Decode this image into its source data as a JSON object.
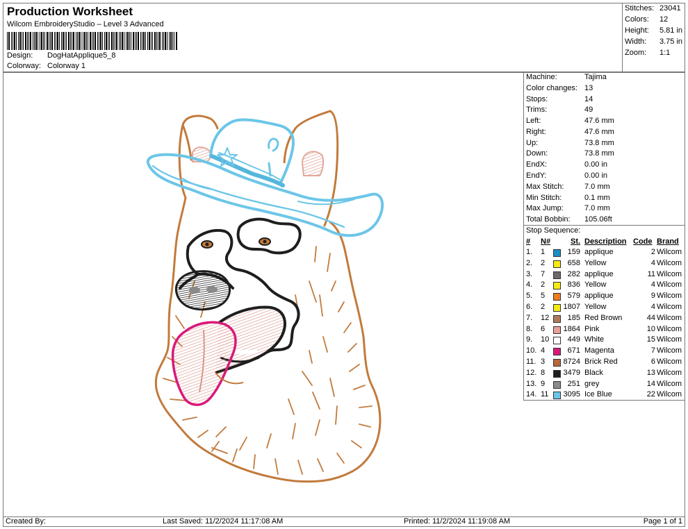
{
  "header": {
    "title": "Production Worksheet",
    "subtitle": "Wilcom EmbroideryStudio – Level 3 Advanced",
    "design_label": "Design:",
    "design_value": "DogHatApplique5_8",
    "colorway_label": "Colorway:",
    "colorway_value": "Colorway 1"
  },
  "stats": [
    {
      "k": "Stitches:",
      "v": "23041"
    },
    {
      "k": "Colors:",
      "v": "12"
    },
    {
      "k": "Height:",
      "v": "5.81 in"
    },
    {
      "k": "Width:",
      "v": "3.75 in"
    },
    {
      "k": "Zoom:",
      "v": "1:1"
    }
  ],
  "machine": [
    {
      "k": "Machine:",
      "v": "Tajima"
    },
    {
      "k": "Color changes:",
      "v": "13"
    },
    {
      "k": "Stops:",
      "v": "14"
    },
    {
      "k": "Trims:",
      "v": "49"
    },
    {
      "k": "Left:",
      "v": "47.6 mm"
    },
    {
      "k": "Right:",
      "v": "47.6 mm"
    },
    {
      "k": "Up:",
      "v": "73.8 mm"
    },
    {
      "k": "Down:",
      "v": "73.8 mm"
    },
    {
      "k": "EndX:",
      "v": "0.00 in"
    },
    {
      "k": "EndY:",
      "v": "0.00 in"
    },
    {
      "k": "Max Stitch:",
      "v": "7.0 mm"
    },
    {
      "k": "Min Stitch:",
      "v": "0.1 mm"
    },
    {
      "k": "Max Jump:",
      "v": "7.0 mm"
    },
    {
      "k": "Total Bobbin:",
      "v": "105.06ft"
    }
  ],
  "stop_sequence": {
    "title": "Stop Sequence:",
    "headers": {
      "num": "#",
      "n": "N#",
      "st": "St.",
      "desc": "Description",
      "code": "Code",
      "brand": "Brand"
    },
    "rows": [
      {
        "num": "1.",
        "n": "1",
        "color": "#1a8fc4",
        "st": "159",
        "desc": "applique",
        "code": "2",
        "brand": "Wilcom"
      },
      {
        "num": "2.",
        "n": "2",
        "color": "#f5ea14",
        "st": "658",
        "desc": "Yellow",
        "code": "4",
        "brand": "Wilcom"
      },
      {
        "num": "3.",
        "n": "7",
        "color": "#6e6a6a",
        "st": "282",
        "desc": "applique",
        "code": "11",
        "brand": "Wilcom"
      },
      {
        "num": "4.",
        "n": "2",
        "color": "#f5ea14",
        "st": "836",
        "desc": "Yellow",
        "code": "4",
        "brand": "Wilcom"
      },
      {
        "num": "5.",
        "n": "5",
        "color": "#f07d1e",
        "st": "579",
        "desc": "applique",
        "code": "9",
        "brand": "Wilcom"
      },
      {
        "num": "6.",
        "n": "2",
        "color": "#f5ea14",
        "st": "1807",
        "desc": "Yellow",
        "code": "4",
        "brand": "Wilcom"
      },
      {
        "num": "7.",
        "n": "12",
        "color": "#b07a5e",
        "st": "185",
        "desc": "Red Brown",
        "code": "44",
        "brand": "Wilcom"
      },
      {
        "num": "8.",
        "n": "6",
        "color": "#e99f9a",
        "st": "1864",
        "desc": "Pink",
        "code": "10",
        "brand": "Wilcom"
      },
      {
        "num": "9.",
        "n": "10",
        "color": "#ffffff",
        "st": "449",
        "desc": "White",
        "code": "15",
        "brand": "Wilcom"
      },
      {
        "num": "10.",
        "n": "4",
        "color": "#d81a7a",
        "st": "671",
        "desc": "Magenta",
        "code": "7",
        "brand": "Wilcom"
      },
      {
        "num": "11.",
        "n": "3",
        "color": "#b8683a",
        "st": "8724",
        "desc": "Brick Red",
        "code": "6",
        "brand": "Wilcom"
      },
      {
        "num": "12.",
        "n": "8",
        "color": "#1e1e1e",
        "st": "3479",
        "desc": "Black",
        "code": "13",
        "brand": "Wilcom"
      },
      {
        "num": "13.",
        "n": "9",
        "color": "#8a8a8a",
        "st": "251",
        "desc": "grey",
        "code": "14",
        "brand": "Wilcom"
      },
      {
        "num": "14.",
        "n": "11",
        "color": "#6cc6e8",
        "st": "3095",
        "desc": "Ice Blue",
        "code": "22",
        "brand": "Wilcom"
      }
    ]
  },
  "footer": {
    "created": "Created By:",
    "saved": "Last Saved: 11/2/2024 11:17:08 AM",
    "printed": "Printed: 11/2/2024 11:19:08 AM",
    "page": "Page 1 of 1"
  },
  "colors": {
    "fur": "#c27a3c",
    "hat": "#6cc6e8",
    "ear_inner": "#e3a79a",
    "tongue": "#e3a79a",
    "tongue_outline": "#d81a7a",
    "black": "#1e1e1e",
    "nose": "#3a3a3a"
  }
}
